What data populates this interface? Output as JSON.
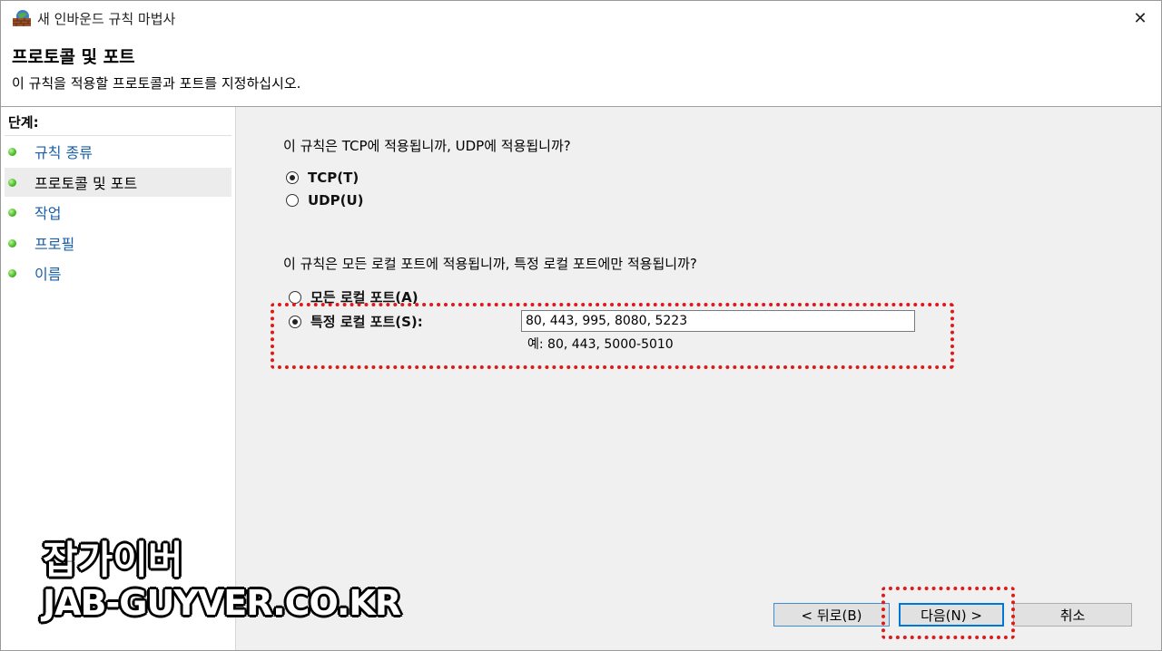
{
  "window": {
    "title": "새 인바운드 규칙 마법사",
    "close_glyph": "✕"
  },
  "header": {
    "title": "프로토콜 및 포트",
    "description": "이 규칙을 적용할 프로토콜과 포트를 지정하십시오."
  },
  "sidebar": {
    "steps_label": "단계:",
    "items": [
      {
        "label": "규칙 종류",
        "active": false
      },
      {
        "label": "프로토콜 및 포트",
        "active": true
      },
      {
        "label": "작업",
        "active": false
      },
      {
        "label": "프로필",
        "active": false
      },
      {
        "label": "이름",
        "active": false
      }
    ]
  },
  "main": {
    "protocol_question": "이 규칙은 TCP에 적용됩니까, UDP에 적용됩니까?",
    "protocol_options": [
      {
        "label": "TCP(T)",
        "checked": true
      },
      {
        "label": "UDP(U)",
        "checked": false
      }
    ],
    "port_question": "이 규칙은 모든 로컬 포트에 적용됩니까, 특정 로컬 포트에만 적용됩니까?",
    "port_options": [
      {
        "label": "모든 로컬 포트(A)",
        "checked": false
      },
      {
        "label": "특정 로컬 포트(S):",
        "checked": true
      }
    ],
    "port_value": "80, 443, 995, 8080, 5223",
    "port_example": "예: 80, 443, 5000-5010"
  },
  "buttons": {
    "back": "< 뒤로(B)",
    "next": "다음(N) >",
    "cancel": "취소"
  },
  "watermark": {
    "line1": "잡가이버",
    "line2": "JAB-GUYVER.CO.KR"
  },
  "colors": {
    "highlight_box": "#e01818",
    "link_blue": "#1a5fa8",
    "step_dot": "#4fbf2a",
    "primary_button_border": "#0078d7"
  },
  "icons": {
    "app": "firewall-wall-icon",
    "close": "close-icon",
    "step": "green-bullet-icon"
  }
}
